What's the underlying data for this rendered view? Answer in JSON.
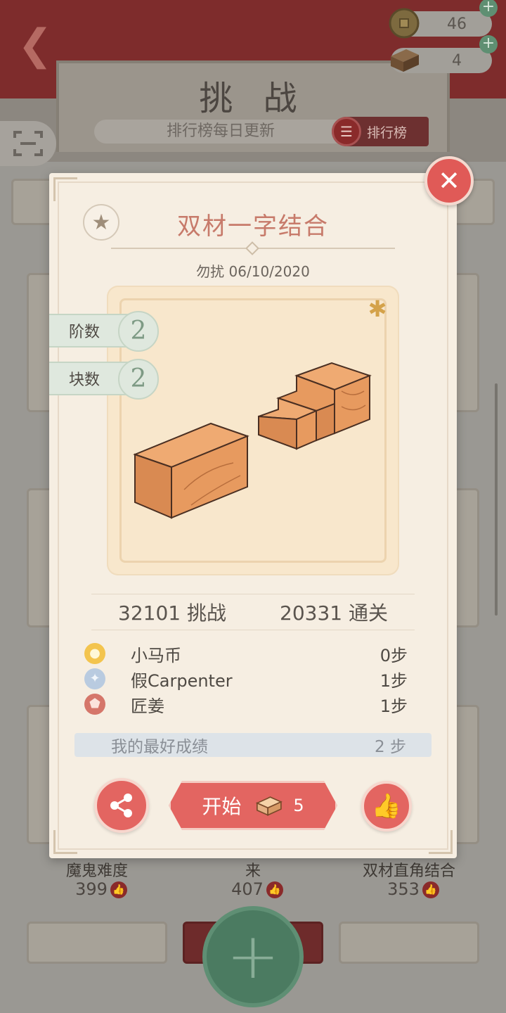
{
  "header": {
    "title": "挑 战",
    "subtitle": "排行榜每日更新",
    "leaderboard_label": "排行榜",
    "coins": "46",
    "tickets": "4"
  },
  "background_cards": [
    {
      "name": "魔鬼难度",
      "likes": "399"
    },
    {
      "name": "来",
      "likes": "407"
    },
    {
      "name": "双材直角结合",
      "likes": "353"
    }
  ],
  "modal": {
    "title": "双材一字结合",
    "author": "勿扰",
    "date": "06/10/2020",
    "tags": [
      {
        "label": "阶数",
        "value": "2"
      },
      {
        "label": "块数",
        "value": "2"
      }
    ],
    "stats": {
      "challenges": "32101",
      "challenges_label": "挑战",
      "clears": "20331",
      "clears_label": "通关"
    },
    "leaderboard": [
      {
        "medal": "gold-medal-icon",
        "name": "小马币",
        "steps": "0步",
        "color": "#f3c44e"
      },
      {
        "medal": "silver-medal-icon",
        "name": "假Carpenter",
        "steps": "1步",
        "color": "#b9cbe0"
      },
      {
        "medal": "bronze-medal-icon",
        "name": "匠姜",
        "steps": "1步",
        "color": "#d5766a"
      }
    ],
    "best": {
      "label": "我的最好成绩",
      "value": "2 步"
    },
    "start": {
      "label": "开始",
      "cost": "5"
    }
  },
  "colors": {
    "accent_red": "#e36561",
    "title_red": "#c77a6a",
    "jade_green": "#7d9a84",
    "wood": "#d88a52"
  }
}
